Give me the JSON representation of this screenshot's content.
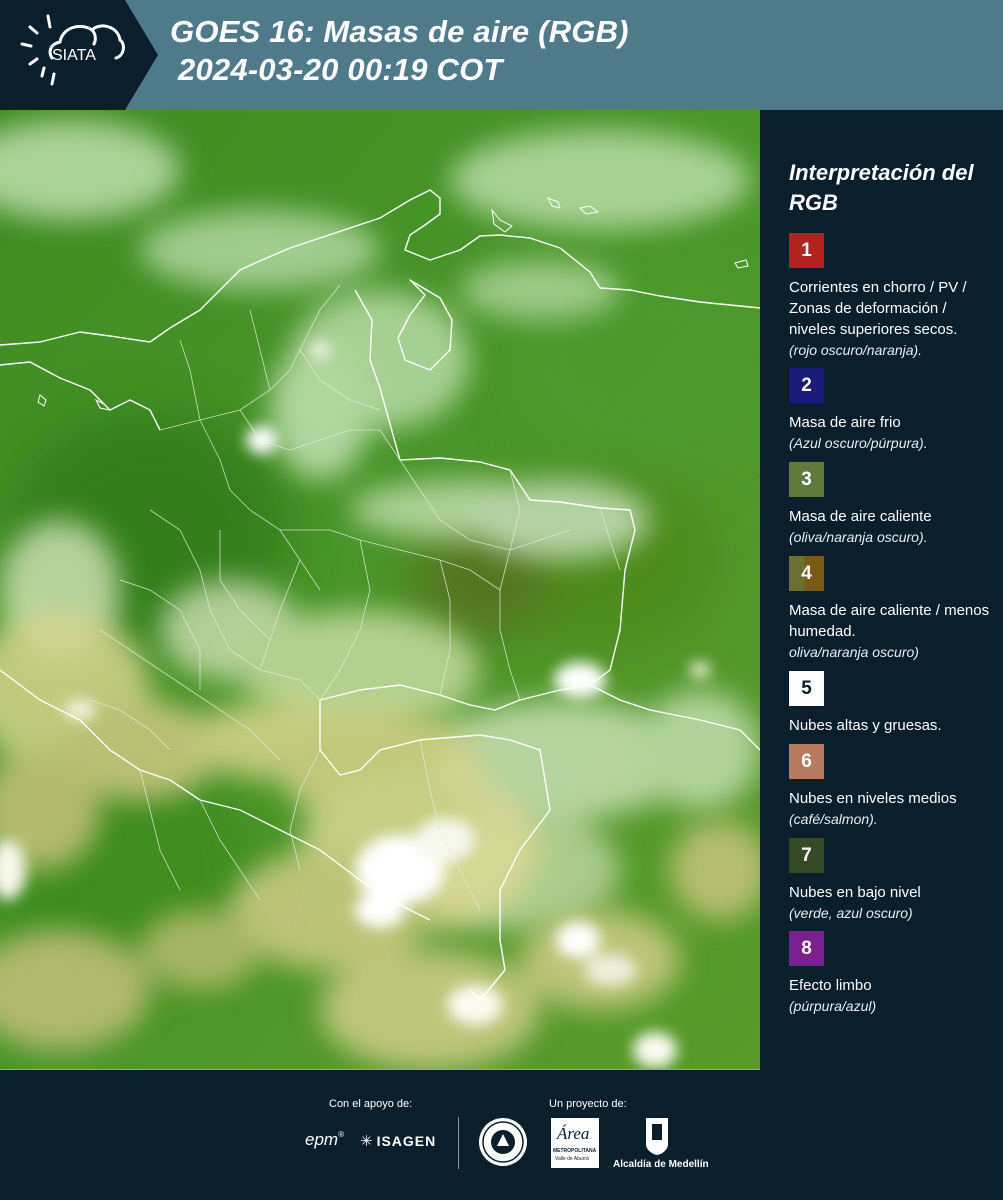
{
  "header": {
    "logo_text": "SIATA",
    "title_line1": "GOES 16: Masas de aire (RGB)",
    "title_line2": "2024-03-20 00:19 COT"
  },
  "legend": {
    "title": "Interpretación del RGB",
    "items": [
      {
        "number": "1",
        "color": "#b3221e",
        "description": "Corrientes en chorro / PV / Zonas de deformación / niveles superiores secos.",
        "note": "(rojo oscuro/naranja)."
      },
      {
        "number": "2",
        "color": "#1a1a7a",
        "description": "Masa de aire frio",
        "note": "(Azul oscuro/púrpura)."
      },
      {
        "number": "3",
        "color": "#5f7a3c",
        "description": "Masa de aire caliente",
        "note": "(oliva/naranja oscuro)."
      },
      {
        "number": "4",
        "color": "#6b5a1e",
        "description": "Masa de aire caliente / menos humedad.",
        "note": "oliva/naranja oscuro)"
      },
      {
        "number": "5",
        "color": "#ffffff",
        "description": "Nubes altas y gruesas.",
        "note": ""
      },
      {
        "number": "6",
        "color": "#b87a5e",
        "description": "Nubes en niveles medios",
        "note": "(café/salmon)."
      },
      {
        "number": "7",
        "color": "#354a25",
        "description": "Nubes en bajo nivel",
        "note": "(verde, azul oscuro)"
      },
      {
        "number": "8",
        "color": "#7b1e8e",
        "description": "Efecto limbo",
        "note": "(púrpura/azul)"
      }
    ]
  },
  "footer": {
    "support_label": "Con el apoyo de:",
    "project_label": "Un proyecto de:",
    "sponsor_epm": "epm",
    "sponsor_isagen": "ISAGEN",
    "partner_area": "Área",
    "partner_area_sub": "METROPOLITANA",
    "partner_area_sub2": "Valle de Aburrá",
    "partner_alcaldia": "Alcaldía de Medellín"
  }
}
